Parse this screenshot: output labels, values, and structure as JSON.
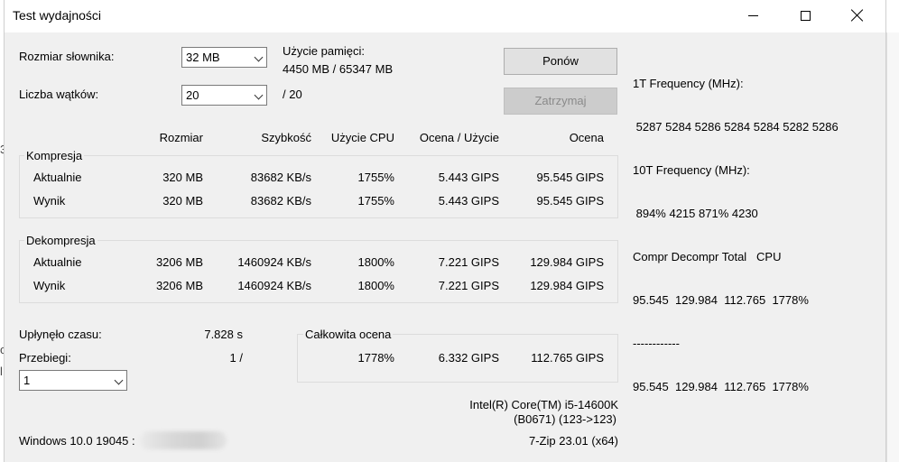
{
  "window": {
    "title": "Test wydajności"
  },
  "settings": {
    "dict_label": "Rozmiar słownika:",
    "dict_value": "32 MB",
    "threads_label": "Liczba wątków:",
    "threads_value": "20",
    "threads_total": "/ 20",
    "mem_label": "Użycie pamięci:",
    "mem_value": "4450 MB / 65347 MB"
  },
  "buttons": {
    "restart": "Ponów",
    "stop": "Zatrzymaj"
  },
  "columns": {
    "size": "Rozmiar",
    "speed": "Szybkość",
    "cpu": "Użycie CPU",
    "rating_usage": "Ocena / Użycie",
    "rating": "Ocena"
  },
  "compression": {
    "label": "Kompresja",
    "current": {
      "label": "Aktualnie",
      "size": "320 MB",
      "speed": "83682 KB/s",
      "cpu": "1755%",
      "rating_usage": "5.443 GIPS",
      "rating": "95.545 GIPS"
    },
    "result": {
      "label": "Wynik",
      "size": "320 MB",
      "speed": "83682 KB/s",
      "cpu": "1755%",
      "rating_usage": "5.443 GIPS",
      "rating": "95.545 GIPS"
    }
  },
  "decompression": {
    "label": "Dekompresja",
    "current": {
      "label": "Aktualnie",
      "size": "3206 MB",
      "speed": "1460924 KB/s",
      "cpu": "1800%",
      "rating_usage": "7.221 GIPS",
      "rating": "129.984 GIPS"
    },
    "result": {
      "label": "Wynik",
      "size": "3206 MB",
      "speed": "1460924 KB/s",
      "cpu": "1800%",
      "rating_usage": "7.221 GIPS",
      "rating": "129.984 GIPS"
    }
  },
  "elapsed": {
    "label": "Upłynęło czasu:",
    "value": "7.828 s"
  },
  "passes": {
    "label": "Przebiegi:",
    "value": "1 /",
    "select_value": "1"
  },
  "total": {
    "label": "Całkowita ocena",
    "cpu": "1778%",
    "rating_usage": "6.332 GIPS",
    "rating": "112.765 GIPS"
  },
  "system": {
    "cpu_name": "Intel(R) Core(TM) i5-14600K",
    "cpu_id": "(B0671) (123->123)",
    "os": "Windows 10.0 19045 :",
    "app": "7-Zip 23.01 (x64)"
  },
  "freq_panel": {
    "line1": "1T Frequency (MHz):",
    "line2": " 5287 5284 5286 5284 5284 5282 5286",
    "line3": "10T Frequency (MHz):",
    "line4": " 894% 4215 871% 4230",
    "line5": "Compr Decompr Total   CPU",
    "line6": "95.545  129.984  112.765  1778%",
    "line7": "------------",
    "line8": "95.545  129.984  112.765  1778%"
  },
  "background": {
    "glyph1": "3",
    "glyph2": "c",
    "glyph3": "l"
  }
}
